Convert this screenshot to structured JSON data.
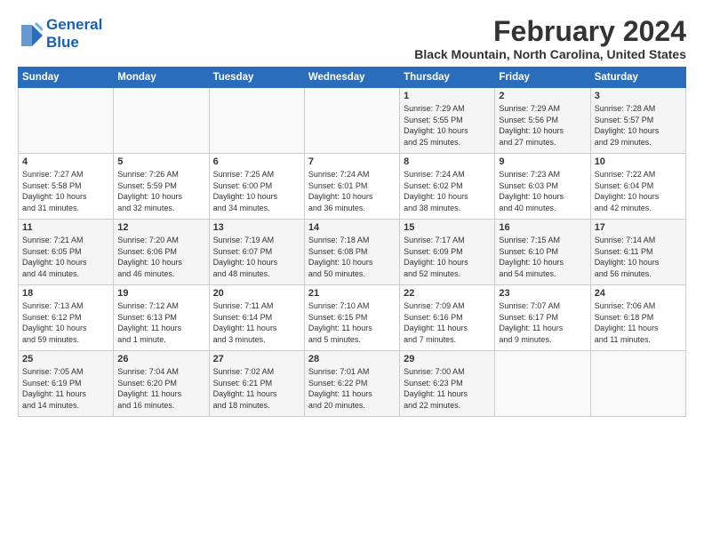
{
  "header": {
    "logo_line1": "General",
    "logo_line2": "Blue",
    "month_title": "February 2024",
    "location": "Black Mountain, North Carolina, United States"
  },
  "days_of_week": [
    "Sunday",
    "Monday",
    "Tuesday",
    "Wednesday",
    "Thursday",
    "Friday",
    "Saturday"
  ],
  "weeks": [
    [
      {
        "day": "",
        "info": ""
      },
      {
        "day": "",
        "info": ""
      },
      {
        "day": "",
        "info": ""
      },
      {
        "day": "",
        "info": ""
      },
      {
        "day": "1",
        "info": "Sunrise: 7:29 AM\nSunset: 5:55 PM\nDaylight: 10 hours\nand 25 minutes."
      },
      {
        "day": "2",
        "info": "Sunrise: 7:29 AM\nSunset: 5:56 PM\nDaylight: 10 hours\nand 27 minutes."
      },
      {
        "day": "3",
        "info": "Sunrise: 7:28 AM\nSunset: 5:57 PM\nDaylight: 10 hours\nand 29 minutes."
      }
    ],
    [
      {
        "day": "4",
        "info": "Sunrise: 7:27 AM\nSunset: 5:58 PM\nDaylight: 10 hours\nand 31 minutes."
      },
      {
        "day": "5",
        "info": "Sunrise: 7:26 AM\nSunset: 5:59 PM\nDaylight: 10 hours\nand 32 minutes."
      },
      {
        "day": "6",
        "info": "Sunrise: 7:25 AM\nSunset: 6:00 PM\nDaylight: 10 hours\nand 34 minutes."
      },
      {
        "day": "7",
        "info": "Sunrise: 7:24 AM\nSunset: 6:01 PM\nDaylight: 10 hours\nand 36 minutes."
      },
      {
        "day": "8",
        "info": "Sunrise: 7:24 AM\nSunset: 6:02 PM\nDaylight: 10 hours\nand 38 minutes."
      },
      {
        "day": "9",
        "info": "Sunrise: 7:23 AM\nSunset: 6:03 PM\nDaylight: 10 hours\nand 40 minutes."
      },
      {
        "day": "10",
        "info": "Sunrise: 7:22 AM\nSunset: 6:04 PM\nDaylight: 10 hours\nand 42 minutes."
      }
    ],
    [
      {
        "day": "11",
        "info": "Sunrise: 7:21 AM\nSunset: 6:05 PM\nDaylight: 10 hours\nand 44 minutes."
      },
      {
        "day": "12",
        "info": "Sunrise: 7:20 AM\nSunset: 6:06 PM\nDaylight: 10 hours\nand 46 minutes."
      },
      {
        "day": "13",
        "info": "Sunrise: 7:19 AM\nSunset: 6:07 PM\nDaylight: 10 hours\nand 48 minutes."
      },
      {
        "day": "14",
        "info": "Sunrise: 7:18 AM\nSunset: 6:08 PM\nDaylight: 10 hours\nand 50 minutes."
      },
      {
        "day": "15",
        "info": "Sunrise: 7:17 AM\nSunset: 6:09 PM\nDaylight: 10 hours\nand 52 minutes."
      },
      {
        "day": "16",
        "info": "Sunrise: 7:15 AM\nSunset: 6:10 PM\nDaylight: 10 hours\nand 54 minutes."
      },
      {
        "day": "17",
        "info": "Sunrise: 7:14 AM\nSunset: 6:11 PM\nDaylight: 10 hours\nand 56 minutes."
      }
    ],
    [
      {
        "day": "18",
        "info": "Sunrise: 7:13 AM\nSunset: 6:12 PM\nDaylight: 10 hours\nand 59 minutes."
      },
      {
        "day": "19",
        "info": "Sunrise: 7:12 AM\nSunset: 6:13 PM\nDaylight: 11 hours\nand 1 minute."
      },
      {
        "day": "20",
        "info": "Sunrise: 7:11 AM\nSunset: 6:14 PM\nDaylight: 11 hours\nand 3 minutes."
      },
      {
        "day": "21",
        "info": "Sunrise: 7:10 AM\nSunset: 6:15 PM\nDaylight: 11 hours\nand 5 minutes."
      },
      {
        "day": "22",
        "info": "Sunrise: 7:09 AM\nSunset: 6:16 PM\nDaylight: 11 hours\nand 7 minutes."
      },
      {
        "day": "23",
        "info": "Sunrise: 7:07 AM\nSunset: 6:17 PM\nDaylight: 11 hours\nand 9 minutes."
      },
      {
        "day": "24",
        "info": "Sunrise: 7:06 AM\nSunset: 6:18 PM\nDaylight: 11 hours\nand 11 minutes."
      }
    ],
    [
      {
        "day": "25",
        "info": "Sunrise: 7:05 AM\nSunset: 6:19 PM\nDaylight: 11 hours\nand 14 minutes."
      },
      {
        "day": "26",
        "info": "Sunrise: 7:04 AM\nSunset: 6:20 PM\nDaylight: 11 hours\nand 16 minutes."
      },
      {
        "day": "27",
        "info": "Sunrise: 7:02 AM\nSunset: 6:21 PM\nDaylight: 11 hours\nand 18 minutes."
      },
      {
        "day": "28",
        "info": "Sunrise: 7:01 AM\nSunset: 6:22 PM\nDaylight: 11 hours\nand 20 minutes."
      },
      {
        "day": "29",
        "info": "Sunrise: 7:00 AM\nSunset: 6:23 PM\nDaylight: 11 hours\nand 22 minutes."
      },
      {
        "day": "",
        "info": ""
      },
      {
        "day": "",
        "info": ""
      }
    ]
  ]
}
